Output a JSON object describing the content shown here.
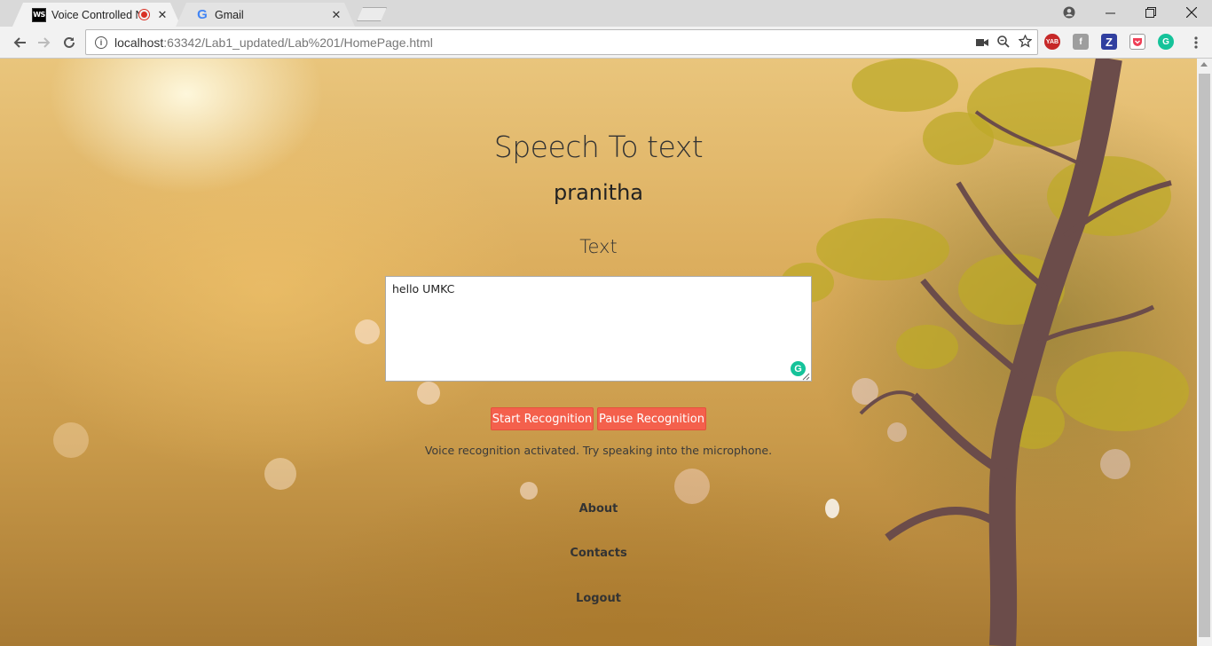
{
  "browser": {
    "tabs": [
      {
        "label": "Voice Controlled Note",
        "favicon": "webstorm-icon",
        "recording": true
      },
      {
        "label": "Gmail",
        "favicon": "google-icon",
        "recording": false
      }
    ],
    "favicon_text": "WS",
    "google_letter": "G",
    "url_host": "localhost",
    "url_rest": ":63342/Lab1_updated/Lab%201/HomePage.html",
    "extensions": [
      {
        "name": "yab-icon",
        "text": "YAB",
        "color": "#c62828"
      },
      {
        "name": "fx-icon",
        "text": "f",
        "color": "#9e9e9e"
      },
      {
        "name": "z-icon",
        "text": "Z",
        "color": "#303f9f"
      },
      {
        "name": "pocket-icon",
        "text": "",
        "color": "#ef3f56"
      },
      {
        "name": "grammarly-ext-icon",
        "text": "G",
        "color": "#15c39a"
      }
    ]
  },
  "page": {
    "title": "Speech To text",
    "user": "pranitha",
    "text_heading": "Text",
    "textarea_value": "hello UMKC",
    "grammarly_letter": "G",
    "start_button": "Start Recognition",
    "pause_button": "Pause Recognition",
    "status": "Voice recognition activated. Try speaking into the microphone.",
    "nav": {
      "about": "About",
      "contacts": "Contacts",
      "logout": "Logout"
    }
  },
  "colors": {
    "button": "#f4604c",
    "recording_dot": "#d93025"
  }
}
